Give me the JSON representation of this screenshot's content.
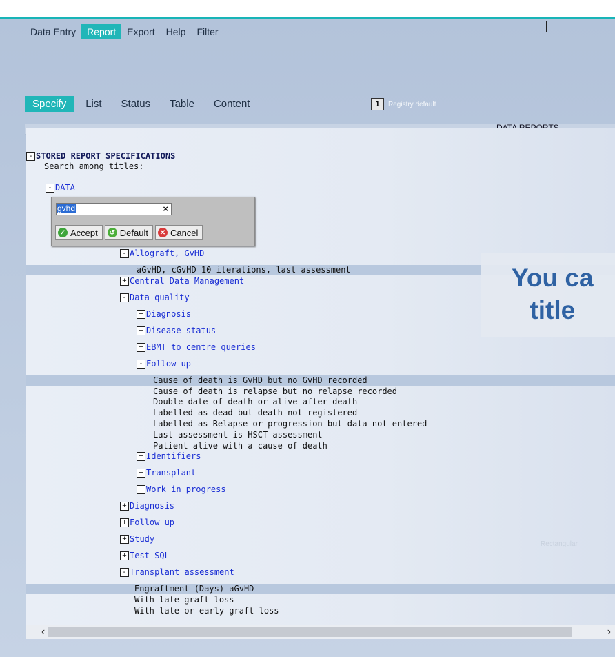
{
  "menu": [
    {
      "label": "Data Entry",
      "active": false
    },
    {
      "label": "Report",
      "active": true
    },
    {
      "label": "Export",
      "active": false
    },
    {
      "label": "Help",
      "active": false
    },
    {
      "label": "Filter",
      "active": false
    }
  ],
  "tabs": [
    {
      "label": "Specify",
      "active": true
    },
    {
      "label": "List",
      "active": false
    },
    {
      "label": "Status",
      "active": false
    },
    {
      "label": "Table",
      "active": false
    },
    {
      "label": "Content",
      "active": false
    }
  ],
  "registry": {
    "number": "1",
    "label": "Registry default"
  },
  "reports_title": "DATA REPORTS",
  "tree": {
    "root": "STORED REPORT SPECIFICATIONS",
    "search_label": "Search among titles:",
    "data_node": "DATA"
  },
  "search": {
    "value": "gvhd",
    "clear": "×",
    "accept": "Accept",
    "default": "Default",
    "cancel": "Cancel"
  },
  "rows": [
    {
      "indent": 1,
      "toggle": "-",
      "text": "Allograft, GvHD",
      "kind": "link"
    },
    {
      "indent": 2,
      "toggle": "",
      "text": "aGvHD, cGvHD 10 iterations, last assessment",
      "kind": "plain",
      "hl": true
    },
    {
      "indent": 1,
      "toggle": "+",
      "text": "Central Data Management",
      "kind": "link"
    },
    {
      "indent": 1,
      "toggle": "-",
      "text": "Data quality",
      "kind": "link"
    },
    {
      "indent": 2,
      "toggle": "+",
      "text": "Diagnosis",
      "kind": "link"
    },
    {
      "indent": 2,
      "toggle": "+",
      "text": "Disease status",
      "kind": "link"
    },
    {
      "indent": 2,
      "toggle": "+",
      "text": "EBMT to centre queries",
      "kind": "link"
    },
    {
      "indent": 2,
      "toggle": "-",
      "text": "Follow up",
      "kind": "link"
    },
    {
      "indent": 3,
      "toggle": "",
      "text": "Cause of death is GvHD but no GvHD recorded",
      "kind": "plain",
      "hl": true
    },
    {
      "indent": 3,
      "toggle": "",
      "text": "Cause of death is relapse but no relapse recorded",
      "kind": "plain"
    },
    {
      "indent": 3,
      "toggle": "",
      "text": "Double date of death or alive after death",
      "kind": "plain"
    },
    {
      "indent": 3,
      "toggle": "",
      "text": "Labelled as dead but death not registered",
      "kind": "plain"
    },
    {
      "indent": 3,
      "toggle": "",
      "text": "Labelled as Relapse or progression but data not entered",
      "kind": "plain"
    },
    {
      "indent": 3,
      "toggle": "",
      "text": "Last assessment is HSCT assessment",
      "kind": "plain"
    },
    {
      "indent": 3,
      "toggle": "",
      "text": "Patient alive with a cause of death",
      "kind": "plain"
    },
    {
      "indent": 2,
      "toggle": "+",
      "text": "Identifiers",
      "kind": "link"
    },
    {
      "indent": 2,
      "toggle": "+",
      "text": "Transplant",
      "kind": "link"
    },
    {
      "indent": 2,
      "toggle": "+",
      "text": "Work in progress",
      "kind": "link"
    },
    {
      "indent": 1,
      "toggle": "+",
      "text": "Diagnosis",
      "kind": "link"
    },
    {
      "indent": 1,
      "toggle": "+",
      "text": "Follow up",
      "kind": "link"
    },
    {
      "indent": 1,
      "toggle": "+",
      "text": "Study",
      "kind": "link"
    },
    {
      "indent": 1,
      "toggle": "+",
      "text": "Test SQL",
      "kind": "link"
    },
    {
      "indent": 1,
      "toggle": "-",
      "text": "Transplant assessment",
      "kind": "link"
    },
    {
      "indent": 4,
      "toggle": "",
      "text": "Engraftment (Days) aGvHD",
      "kind": "plain",
      "hl": true
    },
    {
      "indent": 4,
      "toggle": "",
      "text": "With late graft loss",
      "kind": "plain"
    },
    {
      "indent": 4,
      "toggle": "",
      "text": "With late or early graft loss",
      "kind": "plain"
    }
  ],
  "overlay": {
    "line1": "You ca",
    "line2": "title"
  },
  "faint_text": "Rectangular"
}
